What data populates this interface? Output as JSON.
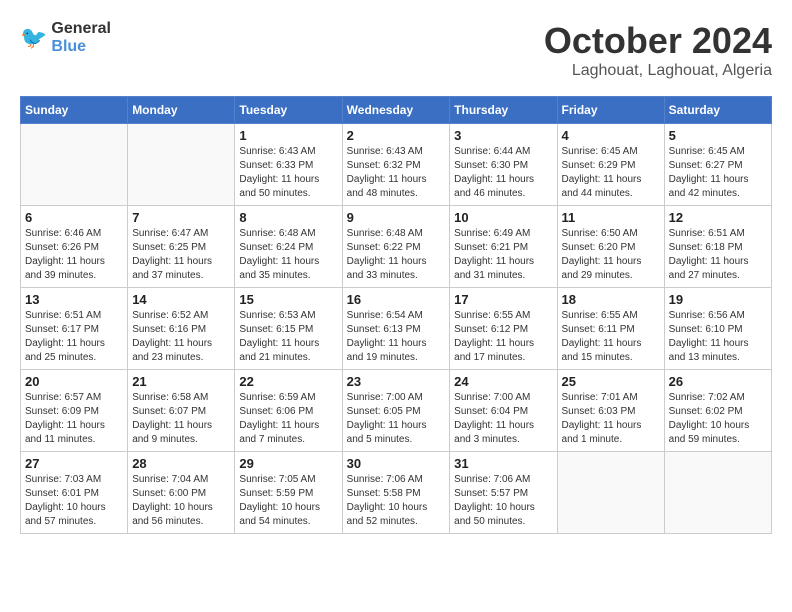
{
  "logo": {
    "general": "General",
    "blue": "Blue"
  },
  "title": "October 2024",
  "location": "Laghouat, Laghouat, Algeria",
  "weekdays": [
    "Sunday",
    "Monday",
    "Tuesday",
    "Wednesday",
    "Thursday",
    "Friday",
    "Saturday"
  ],
  "weeks": [
    [
      {
        "day": "",
        "info": ""
      },
      {
        "day": "",
        "info": ""
      },
      {
        "day": "1",
        "info": "Sunrise: 6:43 AM\nSunset: 6:33 PM\nDaylight: 11 hours and 50 minutes."
      },
      {
        "day": "2",
        "info": "Sunrise: 6:43 AM\nSunset: 6:32 PM\nDaylight: 11 hours and 48 minutes."
      },
      {
        "day": "3",
        "info": "Sunrise: 6:44 AM\nSunset: 6:30 PM\nDaylight: 11 hours and 46 minutes."
      },
      {
        "day": "4",
        "info": "Sunrise: 6:45 AM\nSunset: 6:29 PM\nDaylight: 11 hours and 44 minutes."
      },
      {
        "day": "5",
        "info": "Sunrise: 6:45 AM\nSunset: 6:27 PM\nDaylight: 11 hours and 42 minutes."
      }
    ],
    [
      {
        "day": "6",
        "info": "Sunrise: 6:46 AM\nSunset: 6:26 PM\nDaylight: 11 hours and 39 minutes."
      },
      {
        "day": "7",
        "info": "Sunrise: 6:47 AM\nSunset: 6:25 PM\nDaylight: 11 hours and 37 minutes."
      },
      {
        "day": "8",
        "info": "Sunrise: 6:48 AM\nSunset: 6:24 PM\nDaylight: 11 hours and 35 minutes."
      },
      {
        "day": "9",
        "info": "Sunrise: 6:48 AM\nSunset: 6:22 PM\nDaylight: 11 hours and 33 minutes."
      },
      {
        "day": "10",
        "info": "Sunrise: 6:49 AM\nSunset: 6:21 PM\nDaylight: 11 hours and 31 minutes."
      },
      {
        "day": "11",
        "info": "Sunrise: 6:50 AM\nSunset: 6:20 PM\nDaylight: 11 hours and 29 minutes."
      },
      {
        "day": "12",
        "info": "Sunrise: 6:51 AM\nSunset: 6:18 PM\nDaylight: 11 hours and 27 minutes."
      }
    ],
    [
      {
        "day": "13",
        "info": "Sunrise: 6:51 AM\nSunset: 6:17 PM\nDaylight: 11 hours and 25 minutes."
      },
      {
        "day": "14",
        "info": "Sunrise: 6:52 AM\nSunset: 6:16 PM\nDaylight: 11 hours and 23 minutes."
      },
      {
        "day": "15",
        "info": "Sunrise: 6:53 AM\nSunset: 6:15 PM\nDaylight: 11 hours and 21 minutes."
      },
      {
        "day": "16",
        "info": "Sunrise: 6:54 AM\nSunset: 6:13 PM\nDaylight: 11 hours and 19 minutes."
      },
      {
        "day": "17",
        "info": "Sunrise: 6:55 AM\nSunset: 6:12 PM\nDaylight: 11 hours and 17 minutes."
      },
      {
        "day": "18",
        "info": "Sunrise: 6:55 AM\nSunset: 6:11 PM\nDaylight: 11 hours and 15 minutes."
      },
      {
        "day": "19",
        "info": "Sunrise: 6:56 AM\nSunset: 6:10 PM\nDaylight: 11 hours and 13 minutes."
      }
    ],
    [
      {
        "day": "20",
        "info": "Sunrise: 6:57 AM\nSunset: 6:09 PM\nDaylight: 11 hours and 11 minutes."
      },
      {
        "day": "21",
        "info": "Sunrise: 6:58 AM\nSunset: 6:07 PM\nDaylight: 11 hours and 9 minutes."
      },
      {
        "day": "22",
        "info": "Sunrise: 6:59 AM\nSunset: 6:06 PM\nDaylight: 11 hours and 7 minutes."
      },
      {
        "day": "23",
        "info": "Sunrise: 7:00 AM\nSunset: 6:05 PM\nDaylight: 11 hours and 5 minutes."
      },
      {
        "day": "24",
        "info": "Sunrise: 7:00 AM\nSunset: 6:04 PM\nDaylight: 11 hours and 3 minutes."
      },
      {
        "day": "25",
        "info": "Sunrise: 7:01 AM\nSunset: 6:03 PM\nDaylight: 11 hours and 1 minute."
      },
      {
        "day": "26",
        "info": "Sunrise: 7:02 AM\nSunset: 6:02 PM\nDaylight: 10 hours and 59 minutes."
      }
    ],
    [
      {
        "day": "27",
        "info": "Sunrise: 7:03 AM\nSunset: 6:01 PM\nDaylight: 10 hours and 57 minutes."
      },
      {
        "day": "28",
        "info": "Sunrise: 7:04 AM\nSunset: 6:00 PM\nDaylight: 10 hours and 56 minutes."
      },
      {
        "day": "29",
        "info": "Sunrise: 7:05 AM\nSunset: 5:59 PM\nDaylight: 10 hours and 54 minutes."
      },
      {
        "day": "30",
        "info": "Sunrise: 7:06 AM\nSunset: 5:58 PM\nDaylight: 10 hours and 52 minutes."
      },
      {
        "day": "31",
        "info": "Sunrise: 7:06 AM\nSunset: 5:57 PM\nDaylight: 10 hours and 50 minutes."
      },
      {
        "day": "",
        "info": ""
      },
      {
        "day": "",
        "info": ""
      }
    ]
  ]
}
